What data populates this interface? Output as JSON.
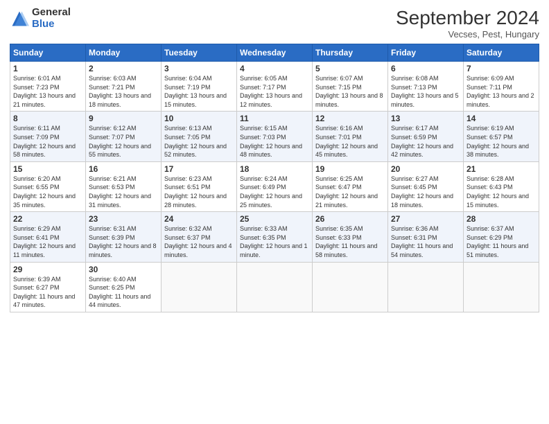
{
  "header": {
    "logo_general": "General",
    "logo_blue": "Blue",
    "title": "September 2024",
    "location": "Vecses, Pest, Hungary"
  },
  "days_of_week": [
    "Sunday",
    "Monday",
    "Tuesday",
    "Wednesday",
    "Thursday",
    "Friday",
    "Saturday"
  ],
  "weeks": [
    [
      {
        "day": 1,
        "sunrise": "6:01 AM",
        "sunset": "7:23 PM",
        "daylight": "13 hours and 21 minutes."
      },
      {
        "day": 2,
        "sunrise": "6:03 AM",
        "sunset": "7:21 PM",
        "daylight": "13 hours and 18 minutes."
      },
      {
        "day": 3,
        "sunrise": "6:04 AM",
        "sunset": "7:19 PM",
        "daylight": "13 hours and 15 minutes."
      },
      {
        "day": 4,
        "sunrise": "6:05 AM",
        "sunset": "7:17 PM",
        "daylight": "13 hours and 12 minutes."
      },
      {
        "day": 5,
        "sunrise": "6:07 AM",
        "sunset": "7:15 PM",
        "daylight": "13 hours and 8 minutes."
      },
      {
        "day": 6,
        "sunrise": "6:08 AM",
        "sunset": "7:13 PM",
        "daylight": "13 hours and 5 minutes."
      },
      {
        "day": 7,
        "sunrise": "6:09 AM",
        "sunset": "7:11 PM",
        "daylight": "13 hours and 2 minutes."
      }
    ],
    [
      {
        "day": 8,
        "sunrise": "6:11 AM",
        "sunset": "7:09 PM",
        "daylight": "12 hours and 58 minutes."
      },
      {
        "day": 9,
        "sunrise": "6:12 AM",
        "sunset": "7:07 PM",
        "daylight": "12 hours and 55 minutes."
      },
      {
        "day": 10,
        "sunrise": "6:13 AM",
        "sunset": "7:05 PM",
        "daylight": "12 hours and 52 minutes."
      },
      {
        "day": 11,
        "sunrise": "6:15 AM",
        "sunset": "7:03 PM",
        "daylight": "12 hours and 48 minutes."
      },
      {
        "day": 12,
        "sunrise": "6:16 AM",
        "sunset": "7:01 PM",
        "daylight": "12 hours and 45 minutes."
      },
      {
        "day": 13,
        "sunrise": "6:17 AM",
        "sunset": "6:59 PM",
        "daylight": "12 hours and 42 minutes."
      },
      {
        "day": 14,
        "sunrise": "6:19 AM",
        "sunset": "6:57 PM",
        "daylight": "12 hours and 38 minutes."
      }
    ],
    [
      {
        "day": 15,
        "sunrise": "6:20 AM",
        "sunset": "6:55 PM",
        "daylight": "12 hours and 35 minutes."
      },
      {
        "day": 16,
        "sunrise": "6:21 AM",
        "sunset": "6:53 PM",
        "daylight": "12 hours and 31 minutes."
      },
      {
        "day": 17,
        "sunrise": "6:23 AM",
        "sunset": "6:51 PM",
        "daylight": "12 hours and 28 minutes."
      },
      {
        "day": 18,
        "sunrise": "6:24 AM",
        "sunset": "6:49 PM",
        "daylight": "12 hours and 25 minutes."
      },
      {
        "day": 19,
        "sunrise": "6:25 AM",
        "sunset": "6:47 PM",
        "daylight": "12 hours and 21 minutes."
      },
      {
        "day": 20,
        "sunrise": "6:27 AM",
        "sunset": "6:45 PM",
        "daylight": "12 hours and 18 minutes."
      },
      {
        "day": 21,
        "sunrise": "6:28 AM",
        "sunset": "6:43 PM",
        "daylight": "12 hours and 15 minutes."
      }
    ],
    [
      {
        "day": 22,
        "sunrise": "6:29 AM",
        "sunset": "6:41 PM",
        "daylight": "12 hours and 11 minutes."
      },
      {
        "day": 23,
        "sunrise": "6:31 AM",
        "sunset": "6:39 PM",
        "daylight": "12 hours and 8 minutes."
      },
      {
        "day": 24,
        "sunrise": "6:32 AM",
        "sunset": "6:37 PM",
        "daylight": "12 hours and 4 minutes."
      },
      {
        "day": 25,
        "sunrise": "6:33 AM",
        "sunset": "6:35 PM",
        "daylight": "12 hours and 1 minute."
      },
      {
        "day": 26,
        "sunrise": "6:35 AM",
        "sunset": "6:33 PM",
        "daylight": "11 hours and 58 minutes."
      },
      {
        "day": 27,
        "sunrise": "6:36 AM",
        "sunset": "6:31 PM",
        "daylight": "11 hours and 54 minutes."
      },
      {
        "day": 28,
        "sunrise": "6:37 AM",
        "sunset": "6:29 PM",
        "daylight": "11 hours and 51 minutes."
      }
    ],
    [
      {
        "day": 29,
        "sunrise": "6:39 AM",
        "sunset": "6:27 PM",
        "daylight": "11 hours and 47 minutes."
      },
      {
        "day": 30,
        "sunrise": "6:40 AM",
        "sunset": "6:25 PM",
        "daylight": "11 hours and 44 minutes."
      },
      null,
      null,
      null,
      null,
      null
    ]
  ]
}
